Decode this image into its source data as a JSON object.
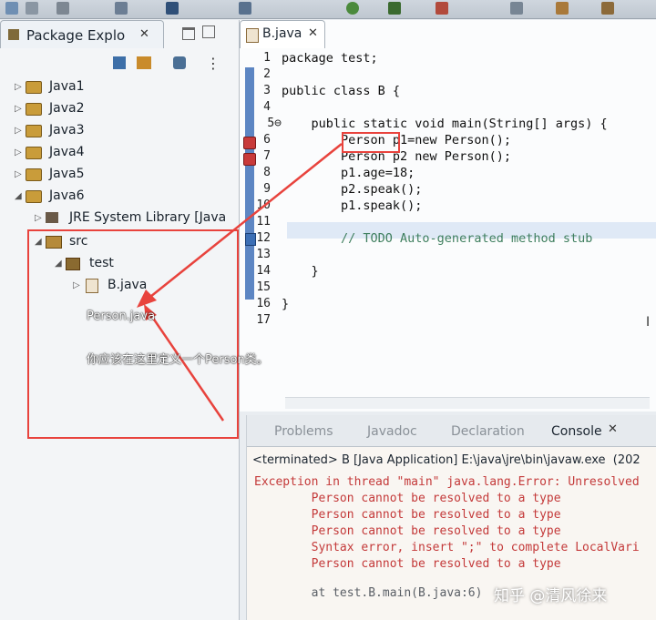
{
  "toolbar": {
    "icons": [
      "new-icon",
      "save-icon",
      "print-icon",
      "search-icon",
      "run-icon",
      "debug-icon",
      "external-tools-icon",
      "nav-back-icon",
      "nav-forward-icon"
    ]
  },
  "package_explorer": {
    "tab_title": "Package Explo",
    "items": [
      {
        "label": "Java1",
        "expanded": false
      },
      {
        "label": "Java2",
        "expanded": false
      },
      {
        "label": "Java3",
        "expanded": false
      },
      {
        "label": "Java4",
        "expanded": false
      },
      {
        "label": "Java5",
        "expanded": false
      },
      {
        "label": "Java6",
        "expanded": true
      }
    ],
    "jre": "JRE System Library [Java",
    "src": "src",
    "test": "test",
    "file": "B.java"
  },
  "editor": {
    "tab_title": "B.java",
    "lines": [
      {
        "num": "1",
        "code": "package test;"
      },
      {
        "num": "2",
        "code": ""
      },
      {
        "num": "3",
        "code": "public class B {"
      },
      {
        "num": "4",
        "code": ""
      },
      {
        "num": "5⊖",
        "code": "    public static void main(String[] args) {"
      },
      {
        "num": "6",
        "code": "        Person p1=new Person();"
      },
      {
        "num": "7",
        "code": "        Person p2 new Person();"
      },
      {
        "num": "8",
        "code": "        p1.age=18;"
      },
      {
        "num": "9",
        "code": "        p2.speak();"
      },
      {
        "num": "10",
        "code": "        p1.speak();"
      },
      {
        "num": "11",
        "code": ""
      },
      {
        "num": "12",
        "code": "        // TODO Auto-generated method stub"
      },
      {
        "num": "13",
        "code": ""
      },
      {
        "num": "14",
        "code": "    }"
      },
      {
        "num": "15",
        "code": ""
      },
      {
        "num": "16",
        "code": "}"
      },
      {
        "num": "17",
        "code": ""
      }
    ]
  },
  "console": {
    "tabs": [
      "Problems",
      "Javadoc",
      "Declaration",
      "Console"
    ],
    "header": "<terminated> B [Java Application] E:\\java\\jre\\bin\\javaw.exe  (202",
    "lines": [
      "Exception in thread \"main\" java.lang.Error: Unresolved",
      "        Person cannot be resolved to a type",
      "        Person cannot be resolved to a type",
      "        Person cannot be resolved to a type",
      "        Syntax error, insert \";\" to complete LocalVari",
      "        Person cannot be resolved to a type",
      "",
      "        at test.B.main(B.java:6)"
    ]
  },
  "annotations": {
    "note1": "Person.java",
    "note2": "你应该在这里定义一个Person类。"
  },
  "watermark": "知乎 @清风徐来",
  "colors": {
    "annotation_red": "#e8433d",
    "error_red": "#c43a3a",
    "gutter_blue": "#5d86c3"
  }
}
